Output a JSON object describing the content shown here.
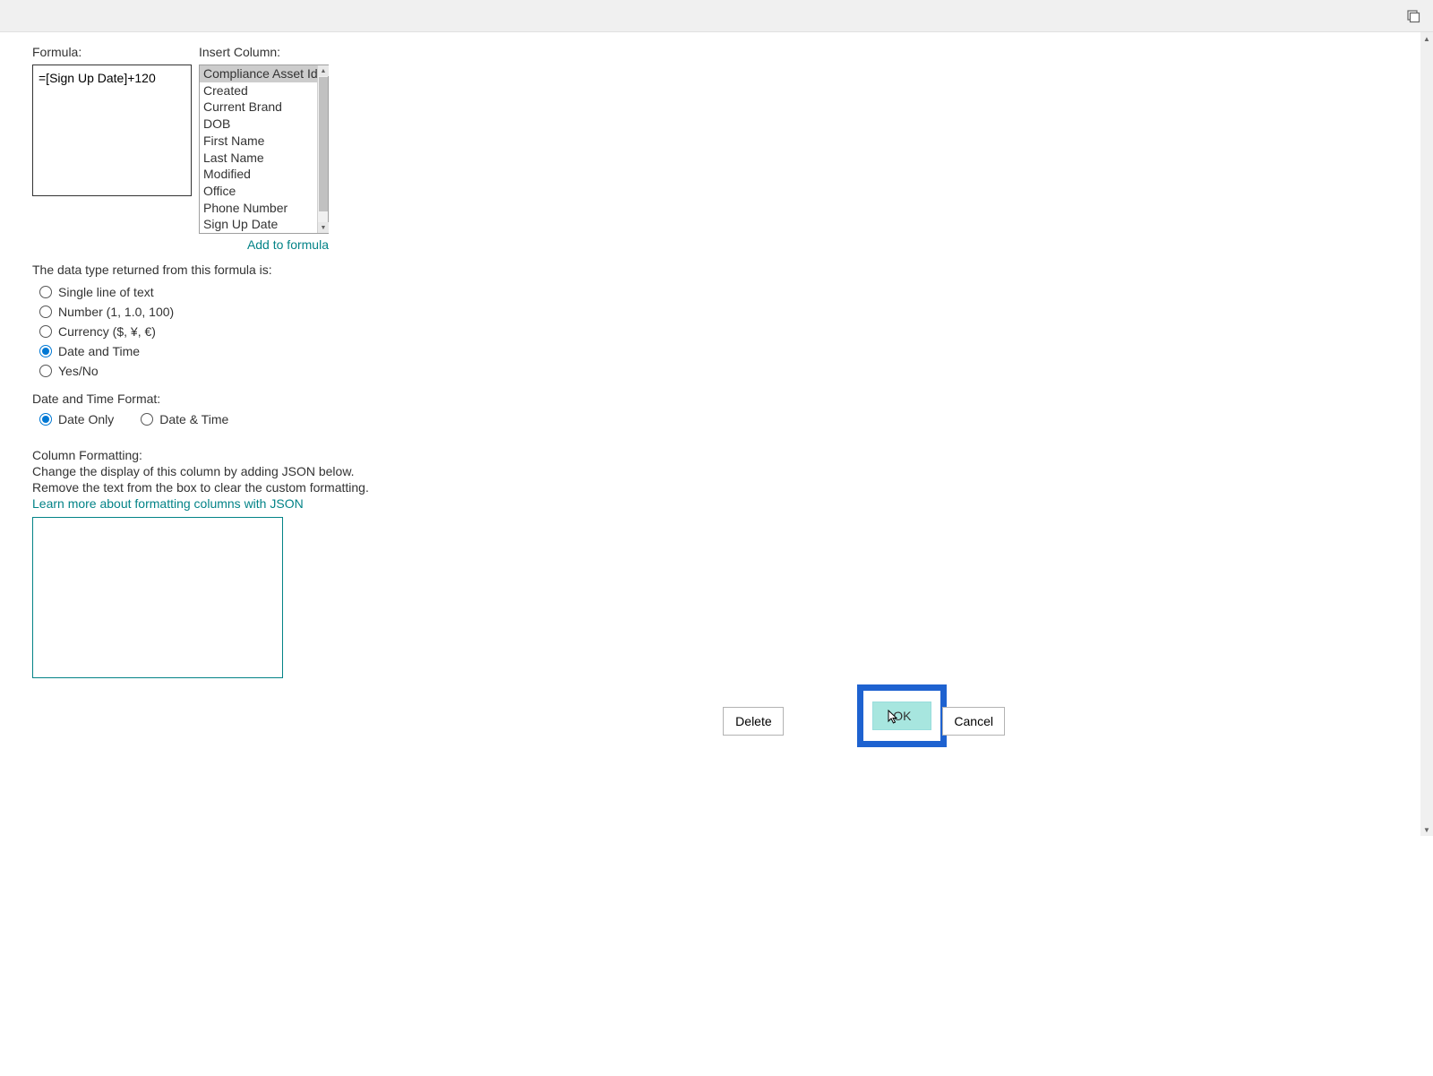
{
  "labels": {
    "formula": "Formula:",
    "insert_column": "Insert Column:",
    "add_to_formula": "Add to formula",
    "data_type_heading": "The data type returned from this formula is:",
    "date_time_format": "Date and Time Format:",
    "column_formatting": "Column Formatting:",
    "cf_line1": "Change the display of this column by adding JSON below.",
    "cf_line2": "Remove the text from the box to clear the custom formatting.",
    "learn_more": "Learn more about formatting columns with JSON"
  },
  "formula_value": "=[Sign Up Date]+120",
  "columns": [
    "Compliance Asset Id",
    "Created",
    "Current Brand",
    "DOB",
    "First Name",
    "Last Name",
    "Modified",
    "Office",
    "Phone Number",
    "Sign Up Date"
  ],
  "data_types": {
    "single_line": "Single line of text",
    "number": "Number (1, 1.0, 100)",
    "currency": "Currency ($, ¥, €)",
    "date_time": "Date and Time",
    "yes_no": "Yes/No"
  },
  "date_formats": {
    "date_only": "Date Only",
    "date_and_time": "Date & Time"
  },
  "json_value": "",
  "buttons": {
    "delete": "Delete",
    "ok": "OK",
    "cancel": "Cancel"
  }
}
